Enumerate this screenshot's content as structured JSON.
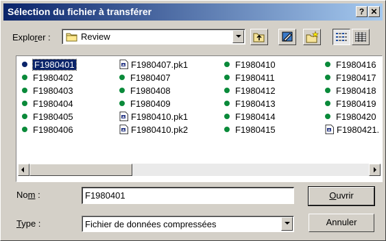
{
  "window": {
    "title": "Sélection du fichier à transférer",
    "help_label": "?",
    "close_label": "✕"
  },
  "explorer": {
    "label_pre": "Explo",
    "label_acc": "r",
    "label_post": "er :",
    "folder": "Review"
  },
  "toolbar": {
    "icons": [
      "up-folder-icon",
      "desktop-icon",
      "new-folder-icon",
      "list-view-icon",
      "details-view-icon"
    ]
  },
  "files": {
    "col1": [
      "F1980401",
      "F1980402",
      "F1980403",
      "F1980404",
      "F1980405",
      "F1980406"
    ],
    "col2": [
      "F1980407.pk1",
      "F1980407",
      "F1980408",
      "F1980409",
      "F1980410.pk1",
      "F1980410.pk2"
    ],
    "col3": [
      "F1980410",
      "F1980411",
      "F1980412",
      "F1980413",
      "F1980414",
      "F1980415"
    ],
    "col4": [
      "F1980416",
      "F1980417",
      "F1980418",
      "F1980419",
      "F1980420",
      "F1980421."
    ],
    "selected": "F1980401"
  },
  "name": {
    "label_pre": "No",
    "label_acc": "m",
    "label_post": " :",
    "value": "F1980401"
  },
  "type": {
    "label_acc": "T",
    "label_post": "ype :",
    "value": "Fichier de données compressées"
  },
  "buttons": {
    "open_acc": "O",
    "open_post": "uvrir",
    "cancel": "Annuler"
  },
  "colors": {
    "title_start": "#0a246a",
    "title_end": "#a6caf0",
    "file_dot": "#0a8a3a",
    "face": "#d4d0c8"
  }
}
